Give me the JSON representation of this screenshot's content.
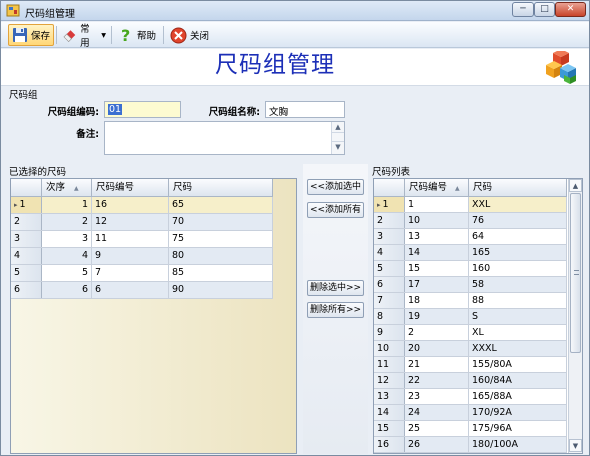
{
  "window": {
    "title": "尺码组管理",
    "controls": [
      "─",
      "□",
      "✕"
    ]
  },
  "toolbar": {
    "items": [
      {
        "label": "保存",
        "icon": "floppy-save-icon"
      },
      {
        "label": "常用",
        "icon": "eraser-icon",
        "dropdown": "▾"
      },
      {
        "label": "帮助",
        "icon": "help-question-icon"
      },
      {
        "label": "关闭",
        "icon": "close-circle-icon"
      }
    ]
  },
  "header": {
    "title": "尺码组管理"
  },
  "group": {
    "section_label": "尺码组",
    "code_label": "尺码组编码:",
    "code_value": "01",
    "name_label": "尺码组名称:",
    "name_value": "文胸",
    "note_label": "备注:",
    "note_value": ""
  },
  "selected": {
    "section_label": "已选择的尺码",
    "columns": [
      "次序",
      "尺码编号",
      "尺码"
    ],
    "sort_marker": "▲",
    "current_marker": "▸",
    "rows": [
      {
        "rownum": "1",
        "order": "1",
        "code": "16",
        "size": "65"
      },
      {
        "rownum": "2",
        "order": "2",
        "code": "12",
        "size": "70"
      },
      {
        "rownum": "3",
        "order": "3",
        "code": "11",
        "size": "75"
      },
      {
        "rownum": "4",
        "order": "4",
        "code": "9",
        "size": "80"
      },
      {
        "rownum": "5",
        "order": "5",
        "code": "7",
        "size": "85"
      },
      {
        "rownum": "6",
        "order": "6",
        "code": "6",
        "size": "90"
      }
    ]
  },
  "actions": {
    "add_selected": "<<添加选中",
    "add_all": "<<添加所有",
    "remove_selected": "删除选中>>",
    "remove_all": "删除所有>>"
  },
  "sizes": {
    "section_label": "尺码列表",
    "columns": [
      "尺码编号",
      "尺码"
    ],
    "sort_marker": "▲",
    "rows": [
      {
        "rownum": "1",
        "code": "1",
        "size": "XXL"
      },
      {
        "rownum": "2",
        "code": "10",
        "size": "76"
      },
      {
        "rownum": "3",
        "code": "13",
        "size": "64"
      },
      {
        "rownum": "4",
        "code": "14",
        "size": "165"
      },
      {
        "rownum": "5",
        "code": "15",
        "size": "160"
      },
      {
        "rownum": "6",
        "code": "17",
        "size": "58"
      },
      {
        "rownum": "7",
        "code": "18",
        "size": "88"
      },
      {
        "rownum": "8",
        "code": "19",
        "size": "S"
      },
      {
        "rownum": "9",
        "code": "2",
        "size": "XL"
      },
      {
        "rownum": "10",
        "code": "20",
        "size": "XXXL"
      },
      {
        "rownum": "11",
        "code": "21",
        "size": "155/80A"
      },
      {
        "rownum": "12",
        "code": "22",
        "size": "160/84A"
      },
      {
        "rownum": "13",
        "code": "23",
        "size": "165/88A"
      },
      {
        "rownum": "14",
        "code": "24",
        "size": "170/92A"
      },
      {
        "rownum": "15",
        "code": "25",
        "size": "175/96A"
      },
      {
        "rownum": "16",
        "code": "26",
        "size": "180/100A"
      }
    ],
    "scroll_up": "▲",
    "scroll_down": "▼"
  },
  "colors": {
    "title_blue": "#1c2fb7",
    "highlight": "#ffd777",
    "row_alt": "#e3eaf3"
  }
}
